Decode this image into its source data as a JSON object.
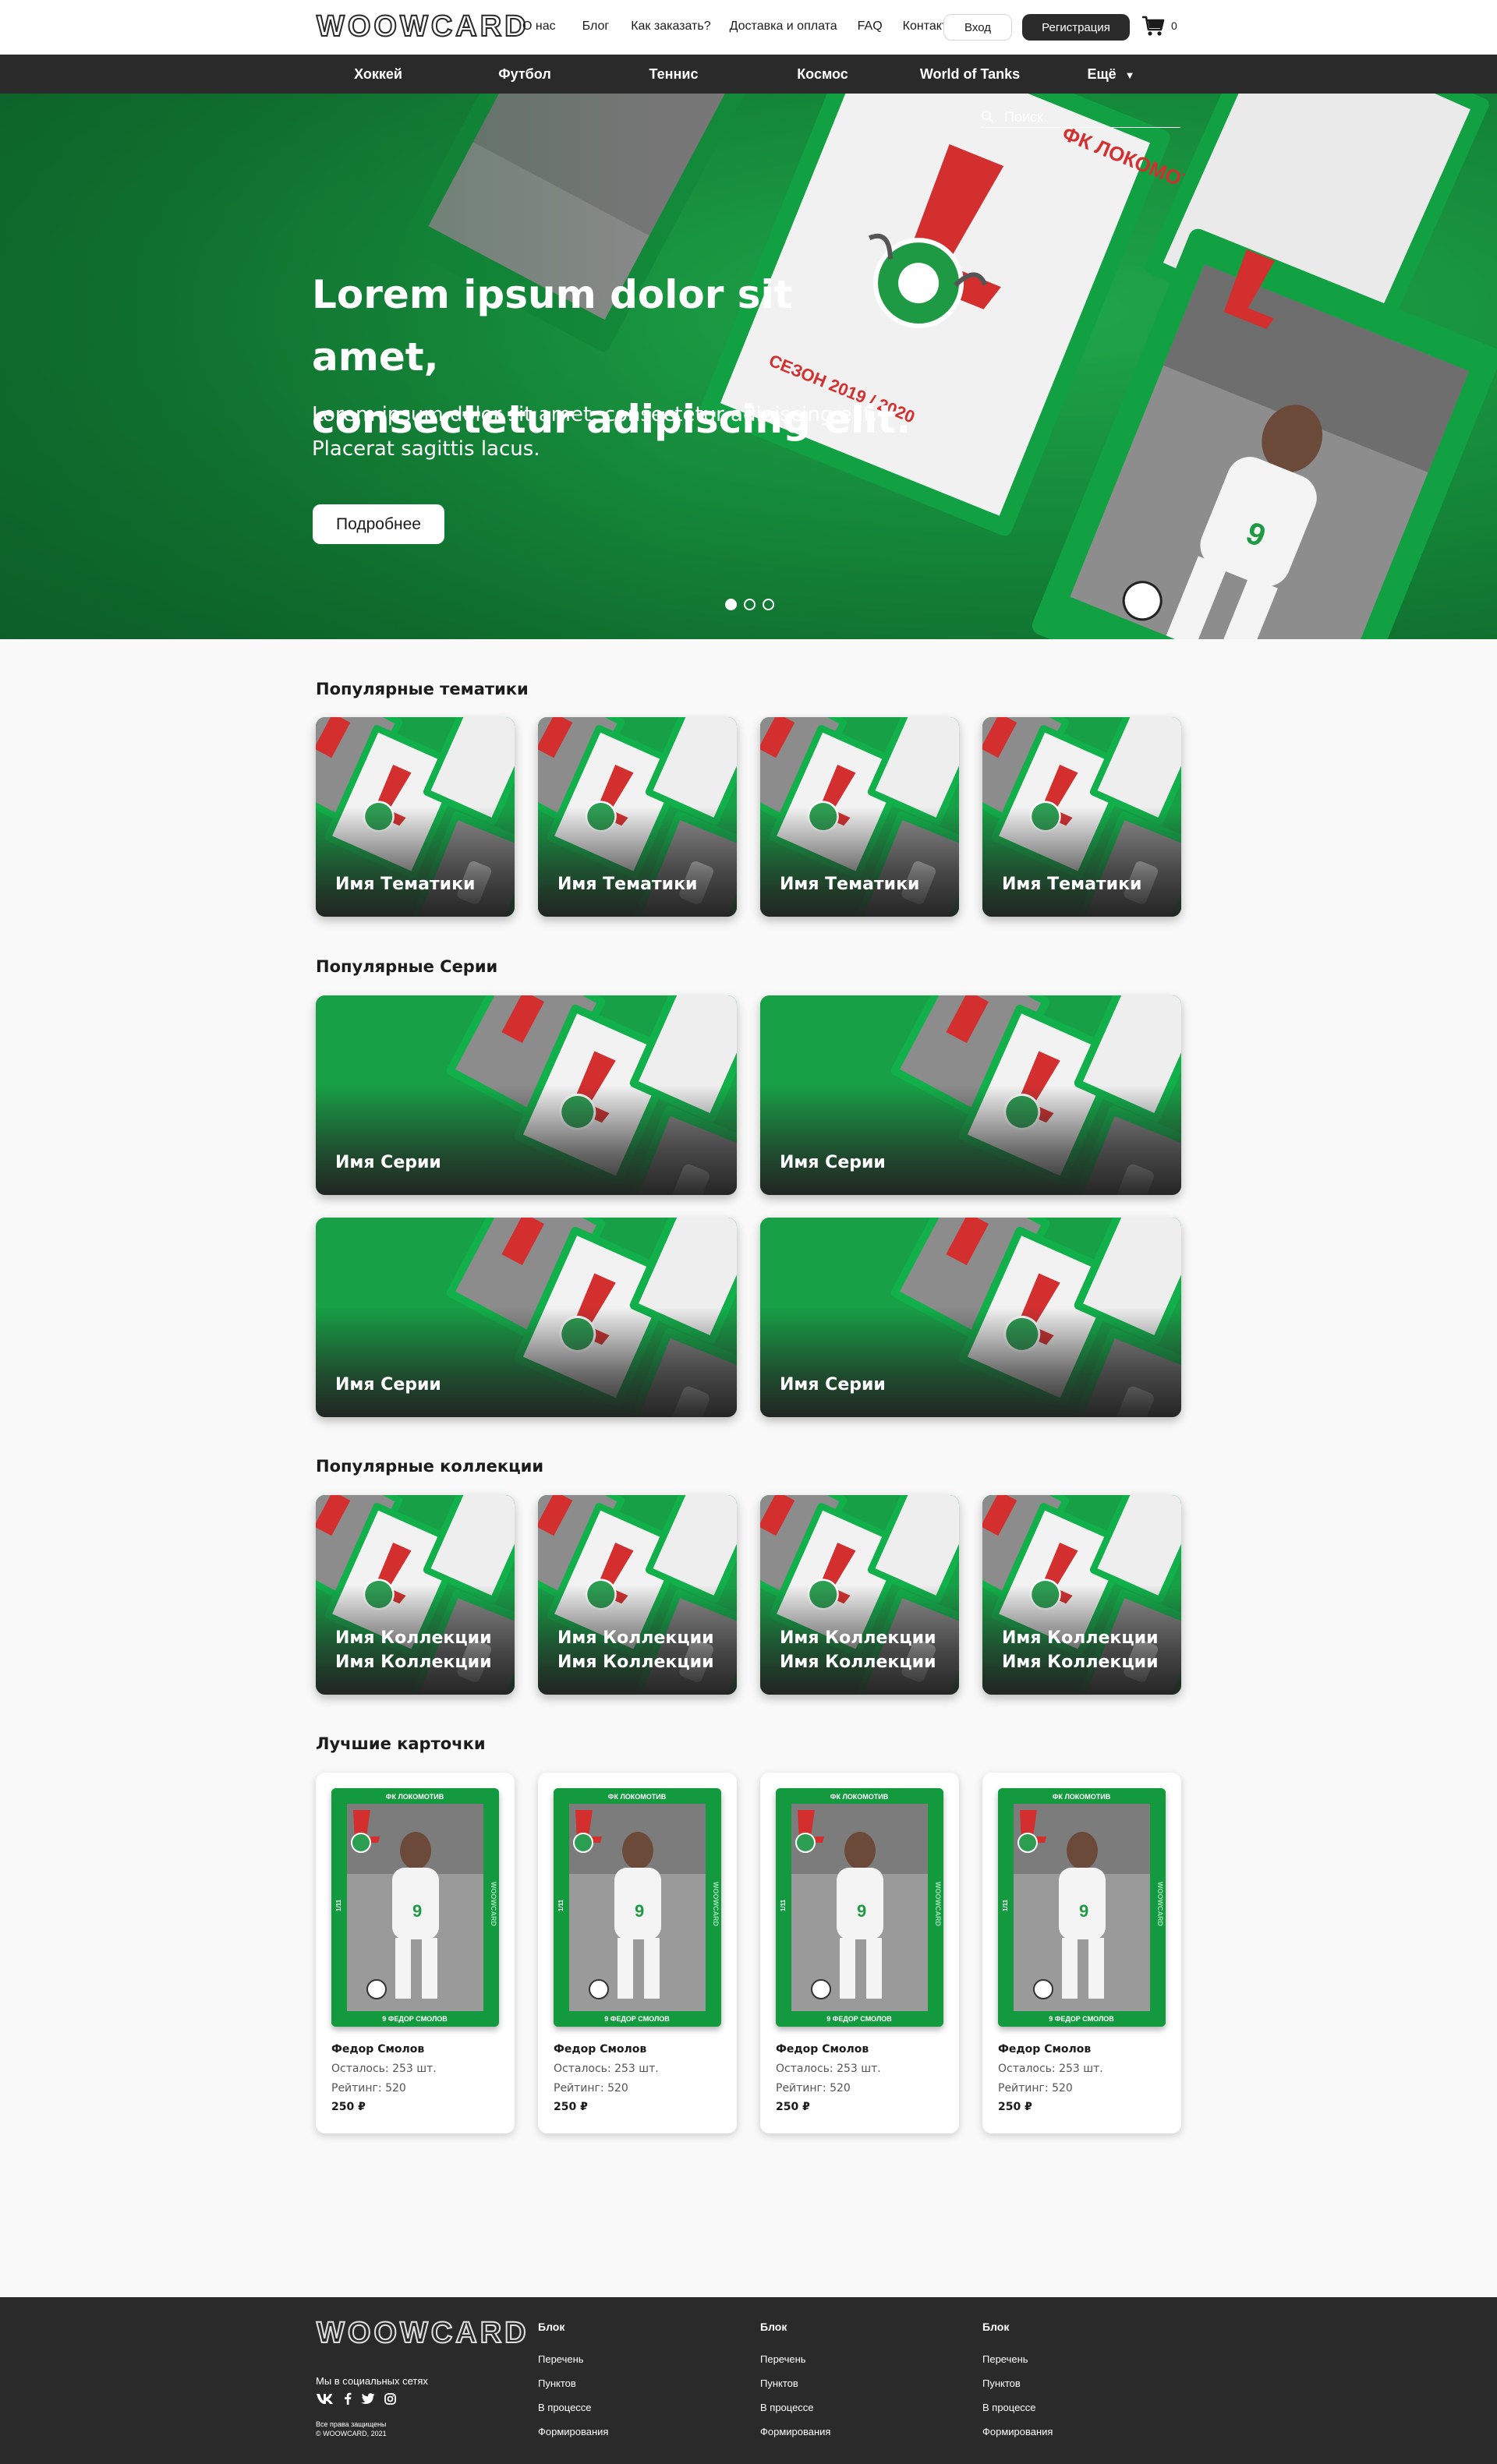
{
  "brand": {
    "logo": "WOOWCARD"
  },
  "header": {
    "nav": [
      "О нас",
      "Блог",
      "Как заказать?",
      "Доставка и оплата",
      "FAQ",
      "Контакты"
    ],
    "login_label": "Вход",
    "register_label": "Регистрация",
    "cart_count": "0"
  },
  "categories": [
    "Хоккей",
    "Футбол",
    "Теннис",
    "Космос",
    "World of Tanks",
    "Ещё"
  ],
  "hero": {
    "search_placeholder": "Поиск",
    "title_line1": "Lorem ipsum dolor sit amet,",
    "title_line2": "consectetur adipiscing elit.",
    "subtitle_line1": "Lorem ipsum dolor sit amet, consectetur adipiscing elit.",
    "subtitle_line2": "Placerat sagittis lacus.",
    "button_label": "Подробнее",
    "slides_total": 3,
    "active_slide": 1
  },
  "sections": {
    "themes": {
      "title": "Популярные тематики",
      "items": [
        "Имя Тематики",
        "Имя Тематики",
        "Имя Тематики",
        "Имя Тематики"
      ]
    },
    "series": {
      "title": "Популярные Серии",
      "items": [
        "Имя Серии",
        "Имя Серии",
        "Имя Серии",
        "Имя Серии"
      ]
    },
    "collections": {
      "title": "Популярные коллекции",
      "items": [
        {
          "line1": "Имя Коллекции",
          "line2": "Имя Коллекции"
        },
        {
          "line1": "Имя Коллекции",
          "line2": "Имя Коллекции"
        },
        {
          "line1": "Имя Коллекции",
          "line2": "Имя Коллекции"
        },
        {
          "line1": "Имя Коллекции",
          "line2": "Имя Коллекции"
        }
      ]
    },
    "best_cards": {
      "title": "Лучшие карточки",
      "items": [
        {
          "name": "Федор Смолов",
          "remaining": "Осталось: 253 шт.",
          "rating": "Рейтинг: 520",
          "price": "250 ₽"
        },
        {
          "name": "Федор Смолов",
          "remaining": "Осталось: 253 шт.",
          "rating": "Рейтинг: 520",
          "price": "250 ₽"
        },
        {
          "name": "Федор Смолов",
          "remaining": "Осталось: 253 шт.",
          "rating": "Рейтинг: 520",
          "price": "250 ₽"
        },
        {
          "name": "Федор Смолов",
          "remaining": "Осталось: 253 шт.",
          "rating": "Рейтинг: 520",
          "price": "250 ₽"
        }
      ]
    }
  },
  "footer": {
    "social_label": "Мы в социальных сетях",
    "copyright_line1": "Все права защищены",
    "copyright_line2": "© WOOWCARD, 2021",
    "columns": [
      {
        "head": "Блок",
        "links": [
          "Перечень",
          "Пунктов",
          "В процессе",
          "Формирования"
        ]
      },
      {
        "head": "Блок",
        "links": [
          "Перечень",
          "Пунктов",
          "В процессе",
          "Формирования"
        ]
      },
      {
        "head": "Блок",
        "links": [
          "Перечень",
          "Пунктов",
          "В процессе",
          "Формирования"
        ]
      }
    ]
  },
  "colors": {
    "brand_green": "#16963f",
    "dark": "#2a2a2a",
    "page_bg": "#f9f9f9",
    "accent_red": "#d32f2f"
  }
}
